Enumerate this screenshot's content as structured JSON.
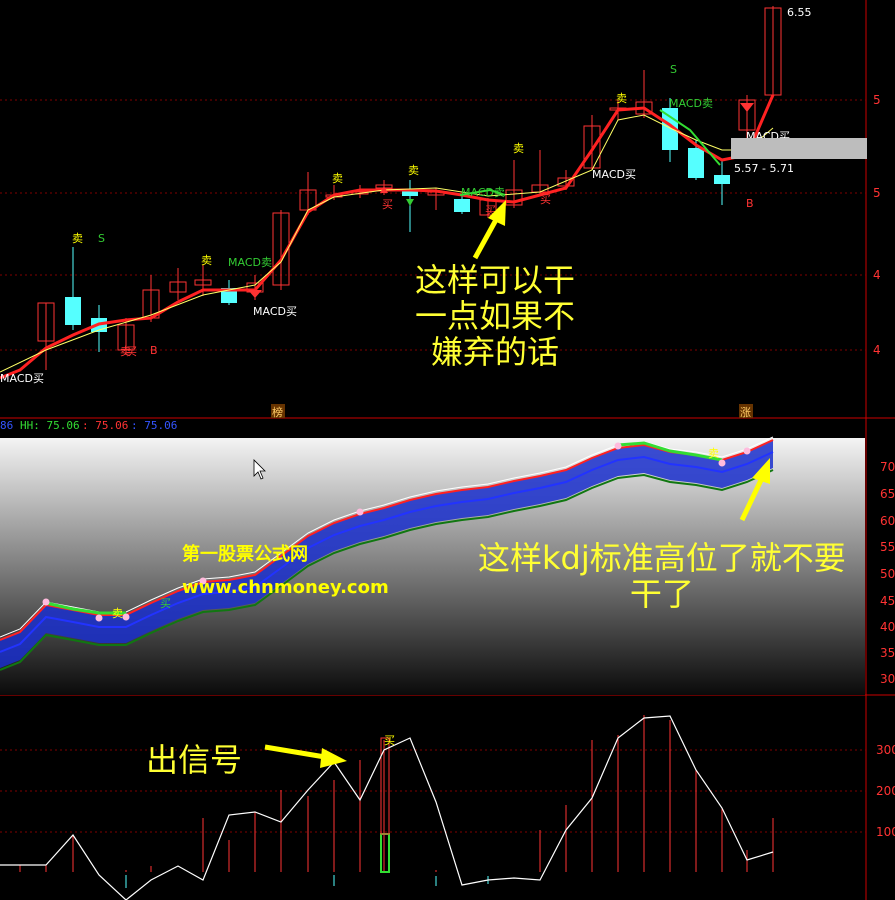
{
  "top_panel": {
    "price_high_label": "6.55",
    "range_label": "5.57 - 5.71",
    "bottom_tags": [
      "榜",
      "涨"
    ],
    "axis_labels": [
      "5",
      "5",
      "4",
      "4"
    ],
    "signal_labels": [
      {
        "text": "MACD买",
        "color": "#ffffff"
      },
      {
        "text": "卖",
        "color": "#ff3333"
      },
      {
        "text": "卖",
        "color": "#ffff00"
      },
      {
        "text": "S",
        "color": "#33cc33"
      },
      {
        "text": "买",
        "color": "#ff3333"
      },
      {
        "text": "B",
        "color": "#ff3333"
      },
      {
        "text": "卖",
        "color": "#ffff00"
      },
      {
        "text": "MACD卖",
        "color": "#33cc33"
      },
      {
        "text": "MACD买",
        "color": "#ffffff"
      },
      {
        "text": "卖",
        "color": "#ffff00"
      },
      {
        "text": "买",
        "color": "#ff3333"
      },
      {
        "text": "卖",
        "color": "#ffff00"
      },
      {
        "text": "MACD卖",
        "color": "#33cc33"
      },
      {
        "text": "买",
        "color": "#ff3333"
      },
      {
        "text": "卖",
        "color": "#ffff00"
      },
      {
        "text": "买",
        "color": "#ff3333"
      },
      {
        "text": "MACD买",
        "color": "#ffffff"
      },
      {
        "text": "卖",
        "color": "#ffff00"
      },
      {
        "text": "MACD卖",
        "color": "#33cc33"
      },
      {
        "text": "S",
        "color": "#33cc33"
      },
      {
        "text": "MACD买",
        "color": "#ffffff"
      },
      {
        "text": "B",
        "color": "#ff3333"
      }
    ],
    "annotation": "这样可以干\n一点如果不\n嫌弃的话"
  },
  "middle_panel": {
    "legend": [
      {
        "text": "86",
        "color": "#3355ff"
      },
      {
        "text": "HH: 75.06",
        "color": "#33dd33"
      },
      {
        "text": ": 75.06",
        "color": "#ff3333"
      },
      {
        "text": ": 75.06",
        "color": "#3355ff"
      }
    ],
    "axis_labels": [
      "70",
      "65",
      "60",
      "55",
      "50",
      "45",
      "40",
      "35",
      "30"
    ],
    "signal_labels": [
      {
        "text": "卖",
        "color": "#ffff00"
      },
      {
        "text": "买",
        "color": "#33cc33"
      },
      {
        "text": "卖",
        "color": "#ffff00"
      }
    ],
    "annotation": "这样kdj标准高位了就不要\n干了",
    "watermark_title": "第一股票公式网",
    "watermark_url": "www.chnmoney.com"
  },
  "bottom_panel": {
    "axis_labels": [
      "300",
      "200",
      "100"
    ],
    "signal_label": "买",
    "annotation": "出信号"
  },
  "colors": {
    "up": "#ff3333",
    "down": "#55ffff",
    "ma_fast": "#ff2222",
    "ma_slow": "#ffff66",
    "grid": "#800000"
  }
}
